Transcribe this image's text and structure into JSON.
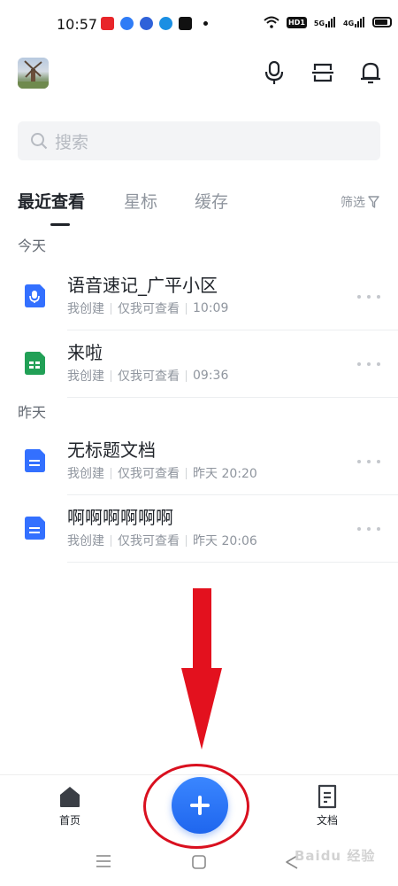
{
  "status_bar": {
    "time": "10:57",
    "notification_icons": [
      "toutiao-icon",
      "baidu-netdisk-icon",
      "baidu-paw-icon",
      "browser-icon",
      "tiktok-icon"
    ],
    "network_tag": "HD1",
    "signal_tag_1": "5G",
    "signal_tag_2": "4G"
  },
  "header": {
    "icons": [
      "microphone-icon",
      "scan-icon",
      "bell-icon"
    ]
  },
  "search": {
    "placeholder": "搜索"
  },
  "tabs": [
    {
      "label": "最近查看",
      "active": true
    },
    {
      "label": "星标",
      "active": false
    },
    {
      "label": "缓存",
      "active": false
    }
  ],
  "filter_label": "筛选",
  "sections": [
    {
      "label": "今天",
      "items": [
        {
          "title": "语音速记_广平小区",
          "creator": "我创建",
          "permission": "仅我可查看",
          "time": "10:09",
          "icon": "voice-note-icon",
          "color": "#3370ff"
        },
        {
          "title": "来啦",
          "creator": "我创建",
          "permission": "仅我可查看",
          "time": "09:36",
          "icon": "sheet-icon",
          "color": "#21a056"
        }
      ]
    },
    {
      "label": "昨天",
      "items": [
        {
          "title": "无标题文档",
          "creator": "我创建",
          "permission": "仅我可查看",
          "time": "昨天 20:20",
          "icon": "doc-icon",
          "color": "#3370ff"
        },
        {
          "title": "啊啊啊啊啊啊",
          "creator": "我创建",
          "permission": "仅我可查看",
          "time": "昨天 20:06",
          "icon": "doc-icon",
          "color": "#3370ff"
        }
      ]
    }
  ],
  "bottom_nav": {
    "home_label": "首页",
    "docs_label": "文档"
  },
  "colors": {
    "accent": "#1f66ee",
    "annotation_red": "#d9101f"
  },
  "watermark": "Baidu 经验"
}
